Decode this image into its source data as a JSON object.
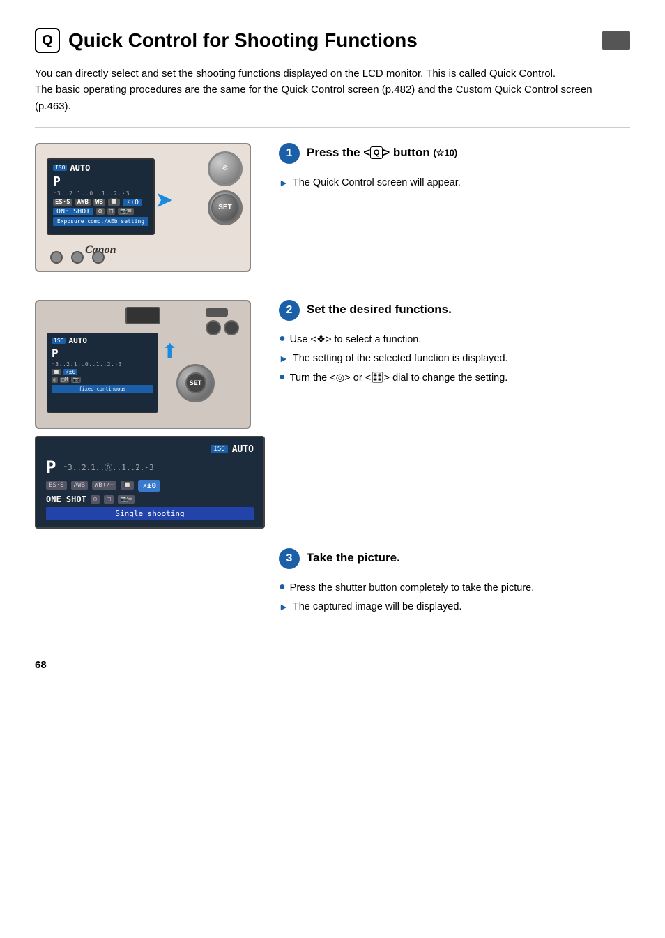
{
  "page": {
    "number": "68",
    "title": "Quick Control for Shooting Functions",
    "title_icon": "Q",
    "intro": [
      "You can directly select and set the shooting functions displayed on the LCD monitor. This is called Quick Control.",
      "The basic operating procedures are the same for the Quick Control screen (p.482) and the Custom Quick Control screen (p.463)."
    ]
  },
  "steps": [
    {
      "number": "1",
      "title_prefix": "Press the <",
      "title_icon": "Q",
      "title_suffix": "> button",
      "title_timer": "(☆10)",
      "bullet_items": [],
      "arrow_items": [
        "The Quick Control screen will appear."
      ]
    },
    {
      "number": "2",
      "title": "Set the desired functions.",
      "bullet_items": [
        "Use <❖> to select a function.",
        "Turn the <◎> or <🎛> dial to change the setting."
      ],
      "arrow_items": [
        "The setting of the selected function is displayed."
      ]
    },
    {
      "number": "3",
      "title": "Take the picture.",
      "bullet_items": [
        "Press the shutter button completely to take the picture."
      ],
      "arrow_items": [
        "The captured image will be displayed."
      ]
    }
  ],
  "lcd_screen_1": {
    "iso": "ISO",
    "auto": "AUTO",
    "mode": "P",
    "scale": "⁻3..2.1..0..1..2.·3",
    "row2": [
      "ES·S",
      "AWB",
      "WB",
      "🔲",
      "⚡±0"
    ],
    "row3": [
      "ONE SHOT",
      "◎",
      "□",
      "📷="
    ],
    "bottom": "Exposure comp./AEb setting",
    "canon": "Canon"
  },
  "lcd_screen_2": {
    "iso": "ISO",
    "auto": "AUTO",
    "mode": "P",
    "scale": "⁻3..2.1..0..1..2.·3",
    "row2": [
      "🔲",
      "⚡±0"
    ],
    "row3": [
      "◎",
      "□M",
      "📷"
    ],
    "bottom": "fixed continuous"
  },
  "lcd_panel": {
    "row1": [
      "ISO",
      "AUTO"
    ],
    "row2_label": "P",
    "row2_scale": "⁻3..2.1..⓪..1..2.·3",
    "row3": [
      "ES·S",
      "AWB",
      "WB+/−",
      "🔲",
      "⚡±0"
    ],
    "row4": [
      "ONE SHOT",
      "◎",
      "□",
      "📷="
    ],
    "bottom": "Single shooting"
  }
}
